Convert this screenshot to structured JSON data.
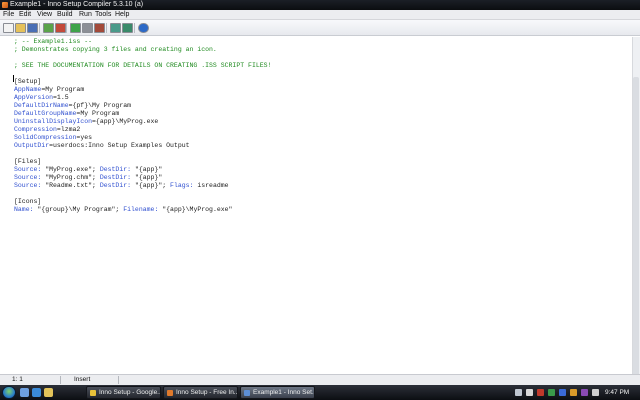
{
  "window": {
    "title": "Example1 - Inno Setup Compiler 5.3.10 (a)"
  },
  "menu": [
    {
      "label": "File",
      "name": "menu-file"
    },
    {
      "label": "Edit",
      "name": "menu-edit"
    },
    {
      "label": "View",
      "name": "menu-view"
    },
    {
      "label": "Build",
      "name": "menu-build"
    },
    {
      "label": "Run",
      "name": "menu-run"
    },
    {
      "label": "Tools",
      "name": "menu-tools"
    },
    {
      "label": "Help",
      "name": "menu-help"
    }
  ],
  "toolbar": {
    "buttons": [
      "new-file-icon",
      "open-folder-icon",
      "save-icon",
      "compile-icon",
      "stop-compile-icon",
      "run-icon",
      "pause-icon",
      "stop-icon",
      "step-into-icon",
      "step-over-icon",
      "help-icon"
    ]
  },
  "editor": {
    "lines": [
      [
        {
          "t": "; -- Example1.iss --",
          "c": "comment"
        }
      ],
      [
        {
          "t": "; Demonstrates copying 3 files and creating an icon.",
          "c": "comment"
        }
      ],
      [],
      [
        {
          "t": "; SEE THE DOCUMENTATION FOR DETAILS ON CREATING .ISS SCRIPT FILES!",
          "c": "comment"
        }
      ],
      [],
      [
        {
          "t": "[Setup]",
          "c": "section"
        }
      ],
      [
        {
          "t": "AppName",
          "c": "key"
        },
        {
          "t": "=My Program",
          "c": "val"
        }
      ],
      [
        {
          "t": "AppVersion",
          "c": "key"
        },
        {
          "t": "=1.5",
          "c": "val"
        }
      ],
      [
        {
          "t": "DefaultDirName",
          "c": "key"
        },
        {
          "t": "={pf}\\My Program",
          "c": "val"
        }
      ],
      [
        {
          "t": "DefaultGroupName",
          "c": "key"
        },
        {
          "t": "=My Program",
          "c": "val"
        }
      ],
      [
        {
          "t": "UninstallDisplayIcon",
          "c": "key"
        },
        {
          "t": "={app}\\MyProg.exe",
          "c": "val"
        }
      ],
      [
        {
          "t": "Compression",
          "c": "key"
        },
        {
          "t": "=lzma2",
          "c": "val"
        }
      ],
      [
        {
          "t": "SolidCompression",
          "c": "key"
        },
        {
          "t": "=yes",
          "c": "val"
        }
      ],
      [
        {
          "t": "OutputDir",
          "c": "key"
        },
        {
          "t": "=userdocs:Inno Setup Examples Output",
          "c": "val"
        }
      ],
      [],
      [
        {
          "t": "[Files]",
          "c": "section"
        }
      ],
      [
        {
          "t": "Source: ",
          "c": "key"
        },
        {
          "t": "\"MyProg.exe\"; ",
          "c": "val"
        },
        {
          "t": "DestDir: ",
          "c": "key"
        },
        {
          "t": "\"{app}\"",
          "c": "val"
        }
      ],
      [
        {
          "t": "Source: ",
          "c": "key"
        },
        {
          "t": "\"MyProg.chm\"; ",
          "c": "val"
        },
        {
          "t": "DestDir: ",
          "c": "key"
        },
        {
          "t": "\"{app}\"",
          "c": "val"
        }
      ],
      [
        {
          "t": "Source: ",
          "c": "key"
        },
        {
          "t": "\"Readme.txt\"; ",
          "c": "val"
        },
        {
          "t": "DestDir: ",
          "c": "key"
        },
        {
          "t": "\"{app}\"; ",
          "c": "val"
        },
        {
          "t": "Flags: ",
          "c": "key"
        },
        {
          "t": "isreadme",
          "c": "val"
        }
      ],
      [],
      [
        {
          "t": "[Icons]",
          "c": "section"
        }
      ],
      [
        {
          "t": "Name: ",
          "c": "key"
        },
        {
          "t": "\"{group}\\My Program\"; ",
          "c": "val"
        },
        {
          "t": "Filename: ",
          "c": "key"
        },
        {
          "t": "\"{app}\\MyProg.exe\"",
          "c": "val"
        }
      ]
    ]
  },
  "status": {
    "position": "1:  1",
    "mode": "Insert"
  },
  "taskbar": {
    "quick_launch": [
      "show-desktop-icon",
      "ie-icon",
      "explorer-icon"
    ],
    "tasks": [
      {
        "label": "Inno Setup - Google...",
        "icon": "chrome-icon",
        "color": "#e8c13a",
        "active": false
      },
      {
        "label": "Inno Setup - Free In...",
        "icon": "firefox-icon",
        "color": "#e07a2c",
        "active": false
      },
      {
        "label": "Example1 - Inno Set...",
        "icon": "inno-setup-icon",
        "color": "#5d8fd6",
        "active": true
      }
    ],
    "tray_icons": [
      "network-icon",
      "volume-icon",
      "tray-app-icon-1",
      "tray-app-icon-2",
      "tray-app-icon-3",
      "tray-app-icon-4",
      "tray-app-icon-5",
      "tray-app-icon-6"
    ],
    "clock": "9:47 PM"
  },
  "colors": {
    "comment": "#1f8a1f",
    "key": "#3050d0",
    "value": "#222222"
  }
}
